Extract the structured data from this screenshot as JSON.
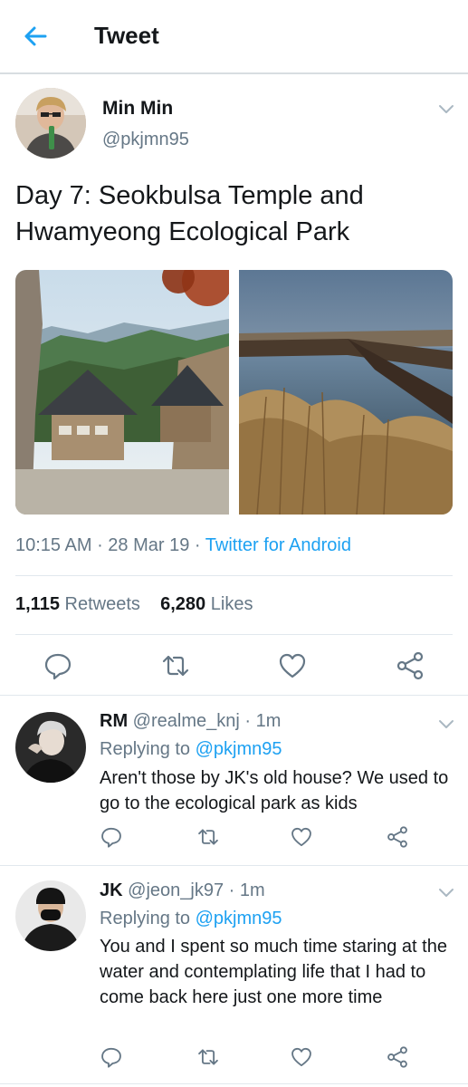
{
  "header": {
    "title": "Tweet"
  },
  "tweet": {
    "author_name": "Min Min",
    "author_handle": "@pkjmn95",
    "text": "Day 7: Seokbulsa Temple and Hwamyeong Ecological Park",
    "time": "10:15 AM",
    "date": "28 Mar 19",
    "client": "Twitter for Android",
    "retweets_count": "1,115",
    "retweets_label": "Retweets",
    "likes_count": "6,280",
    "likes_label": "Likes"
  },
  "replies": [
    {
      "name": "RM",
      "handle": "@realme_knj",
      "time": "1m",
      "replying_label": "Replying to",
      "replying_to": "@pkjmn95",
      "text": "Aren't those by JK's old house? We used to go to the ecological park as kids"
    },
    {
      "name": "JK",
      "handle": "@jeon_jk97",
      "time": "1m",
      "replying_label": "Replying to",
      "replying_to": "@pkjmn95",
      "text": "You and I spent so much time staring at the water and contemplating life that I had to come back here just one more time"
    }
  ],
  "icons": {
    "back": "arrow-left-icon",
    "more": "chevron-down-icon",
    "reply": "speech-bubble-icon",
    "retweet": "retweet-icon",
    "like": "heart-icon",
    "share": "share-icon"
  },
  "colors": {
    "accent": "#1da1f2",
    "secondary_text": "#657786",
    "divider": "#e1e8ed"
  }
}
